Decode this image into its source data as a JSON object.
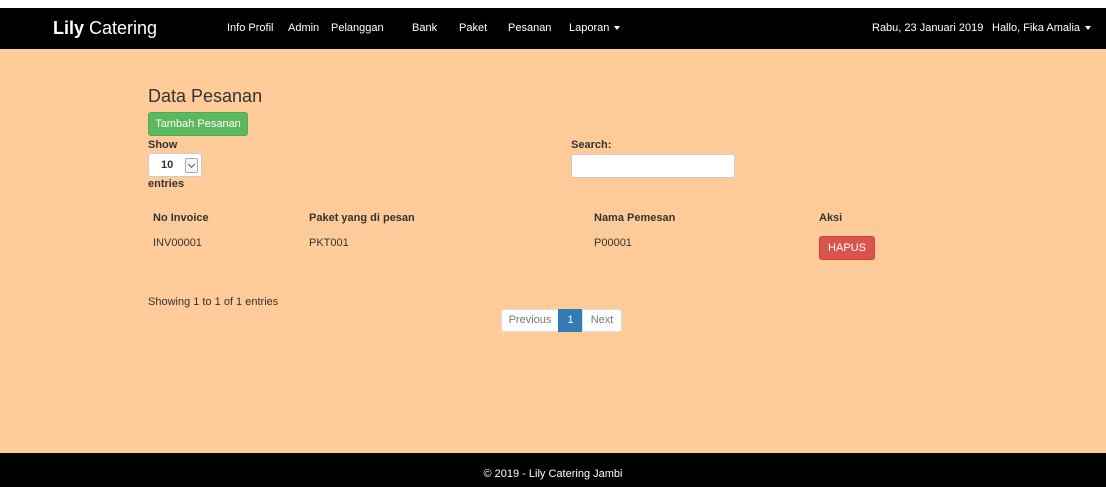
{
  "navbar": {
    "brand_bold": "Lily",
    "brand_rest": " Catering",
    "links": [
      "Info Profil",
      "Admin",
      "Pelanggan",
      "Bank",
      "Paket",
      "Pesanan",
      "Laporan"
    ],
    "date": "Rabu, 23 Januari 2019",
    "user": "Hallo, Fika Amalia"
  },
  "page": {
    "title": "Data Pesanan",
    "add_button": "Tambah Pesanan",
    "show_label": "Show",
    "show_value": "10",
    "entries_label": "entries",
    "search_label": "Search:",
    "search_value": ""
  },
  "table": {
    "columns": [
      "No Invoice",
      "Paket yang di pesan",
      "Nama Pemesan",
      "Aksi"
    ],
    "rows": [
      {
        "invoice": "INV00001",
        "paket": "PKT001",
        "pemesan": "P00001",
        "action": "HAPUS"
      }
    ]
  },
  "pagination": {
    "info": "Showing 1 to 1 of 1 entries",
    "previous": "Previous",
    "current": "1",
    "next": "Next"
  },
  "footer": {
    "text": "© 2019 - Lily Catering Jambi"
  }
}
